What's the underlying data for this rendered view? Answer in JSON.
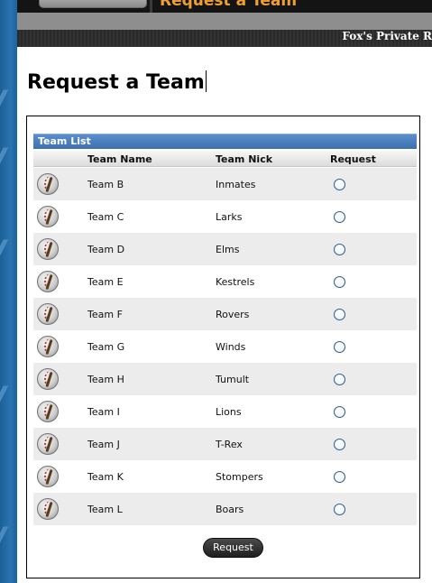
{
  "header": {
    "top_title": "Request a Team",
    "site_name": "Fox's Private R"
  },
  "page": {
    "title": "Request a Team"
  },
  "team_list": {
    "title": "Team List",
    "columns": {
      "name": "Team Name",
      "nick": "Team Nick",
      "request": "Request"
    },
    "rows": [
      {
        "name": "Team B",
        "nick": "Inmates",
        "icon": "baseball-icon",
        "selected": false
      },
      {
        "name": "Team C",
        "nick": "Larks",
        "icon": "baseball-icon",
        "selected": false
      },
      {
        "name": "Team D",
        "nick": "Elms",
        "icon": "baseball-icon",
        "selected": false
      },
      {
        "name": "Team E",
        "nick": "Kestrels",
        "icon": "baseball-icon",
        "selected": false
      },
      {
        "name": "Team F",
        "nick": "Rovers",
        "icon": "baseball-icon",
        "selected": false
      },
      {
        "name": "Team G",
        "nick": "Winds",
        "icon": "baseball-icon",
        "selected": false
      },
      {
        "name": "Team H",
        "nick": "Tumult",
        "icon": "baseball-icon",
        "selected": false
      },
      {
        "name": "Team I",
        "nick": "Lions",
        "icon": "baseball-icon",
        "selected": false
      },
      {
        "name": "Team J",
        "nick": "T-Rex",
        "icon": "baseball-icon",
        "selected": false
      },
      {
        "name": "Team K",
        "nick": "Stompers",
        "icon": "baseball-icon",
        "selected": false
      },
      {
        "name": "Team L",
        "nick": "Boars",
        "icon": "baseball-icon",
        "selected": false
      }
    ],
    "submit_label": "Request"
  },
  "colors": {
    "header_blue": "#3b6fae",
    "accent_orange": "#f0a030",
    "strip_blue": "#2a74b0"
  }
}
